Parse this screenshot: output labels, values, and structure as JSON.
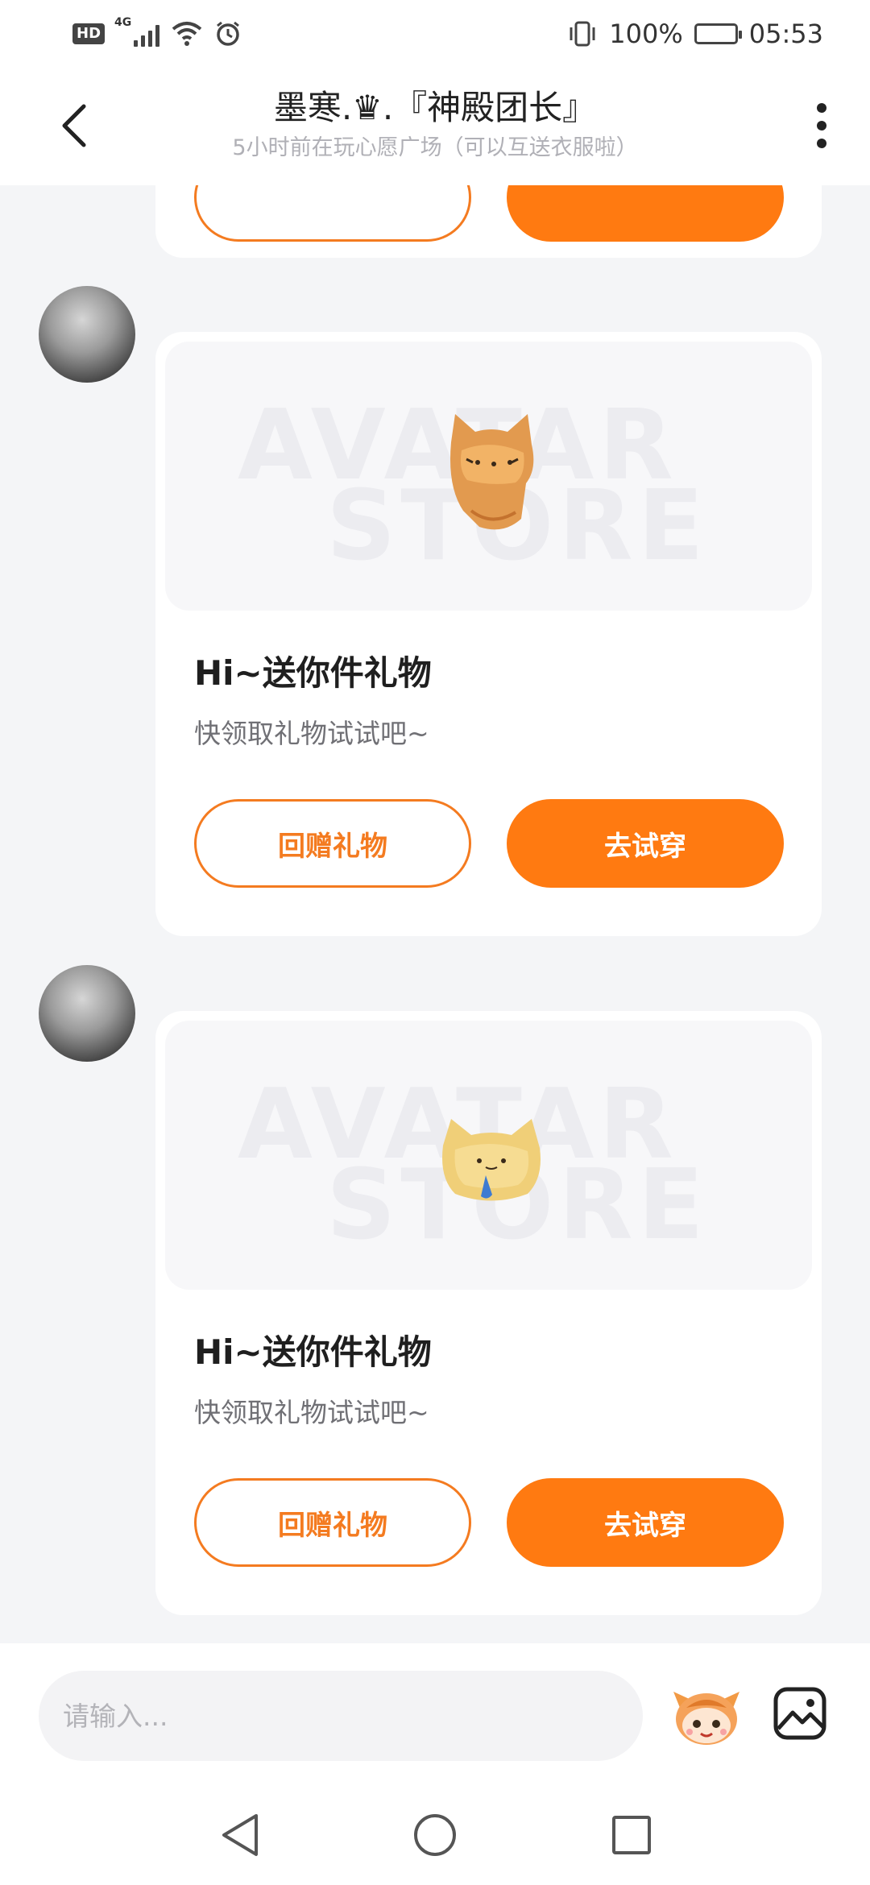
{
  "status_bar": {
    "left_badge": "HD",
    "network": "4G",
    "battery": "100%",
    "time": "05:53"
  },
  "header": {
    "title": "墨寒.♛.『神殿团长』",
    "subtitle": "5小时前在玩心愿广场（可以互送衣服啦）"
  },
  "messages": [
    {
      "card_title": "Hi~送你件礼物",
      "card_subtitle": "快领取礼物试试吧~",
      "return_gift_label": "回赠礼物",
      "try_on_label": "去试穿",
      "watermark_line1": "AVATAR",
      "watermark_line2": "STORE"
    },
    {
      "card_title": "Hi~送你件礼物",
      "card_subtitle": "快领取礼物试试吧~",
      "return_gift_label": "回赠礼物",
      "try_on_label": "去试穿",
      "watermark_line1": "AVATAR",
      "watermark_line2": "STORE"
    }
  ],
  "input": {
    "placeholder": "请输入..."
  },
  "colors": {
    "accent": "#ff7a11",
    "background": "#f4f5f7"
  }
}
